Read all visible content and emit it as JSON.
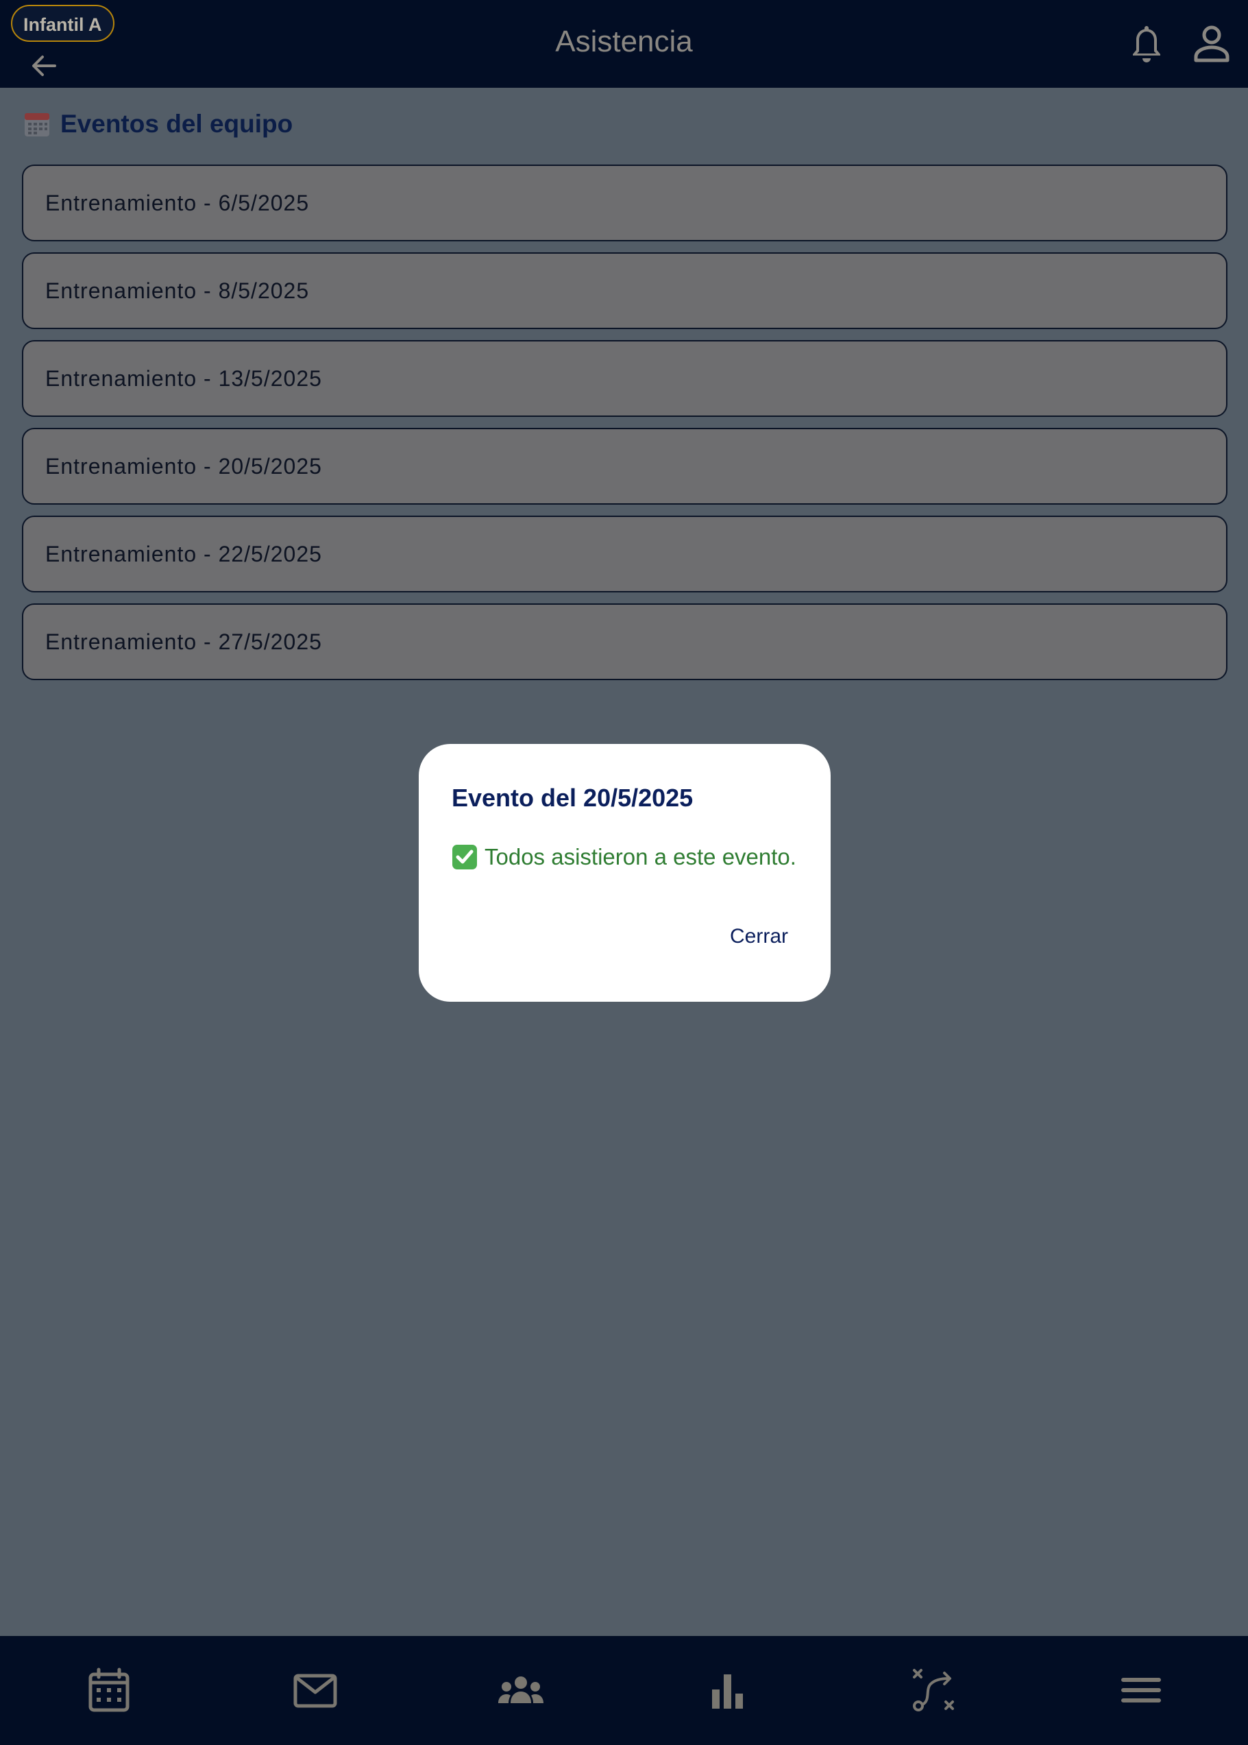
{
  "header": {
    "team_chip": "Infantil A",
    "title": "Asistencia",
    "icons": [
      "back-arrow-icon",
      "bell-icon",
      "user-icon"
    ]
  },
  "section": {
    "emoji": "🗓️",
    "title": "Eventos del equipo"
  },
  "events": [
    {
      "label": "Entrenamiento - 6/5/2025"
    },
    {
      "label": "Entrenamiento - 8/5/2025"
    },
    {
      "label": "Entrenamiento - 13/5/2025"
    },
    {
      "label": "Entrenamiento - 20/5/2025"
    },
    {
      "label": "Entrenamiento - 22/5/2025"
    },
    {
      "label": "Entrenamiento - 27/5/2025"
    }
  ],
  "dialog": {
    "title": "Evento del 20/5/2025",
    "message": "Todos asistieron a este evento.",
    "message_icon": "check-mark-icon",
    "close_label": "Cerrar"
  },
  "bottom_nav": {
    "items": [
      "calendar-icon",
      "mail-icon",
      "team-icon",
      "stats-icon",
      "tactics-icon",
      "menu-icon"
    ]
  },
  "colors": {
    "header_bg": "#020d24",
    "overlay_bg": "#535d67",
    "accent_navy": "#0b1f5c",
    "success_green": "#2f7d32",
    "chip_border": "#b8860b"
  }
}
